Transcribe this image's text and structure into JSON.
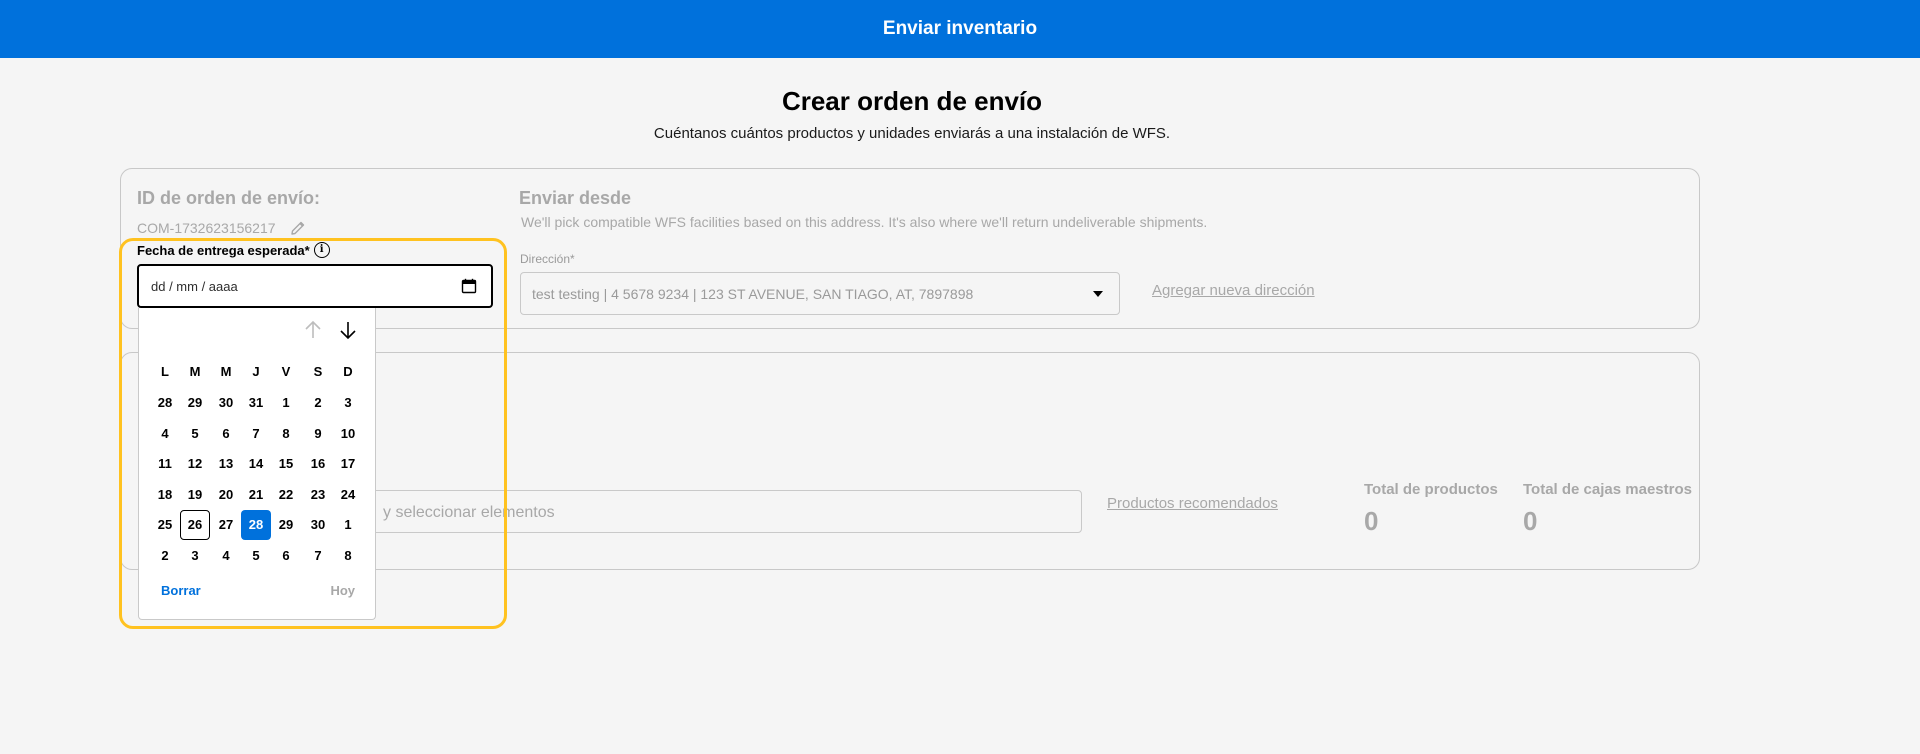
{
  "header": {
    "title": "Enviar inventario"
  },
  "page": {
    "title": "Crear orden de envío",
    "subtitle": "Cuéntanos cuántos productos y unidades enviarás a una instalación de WFS."
  },
  "shipment": {
    "id_label": "ID de orden de envío:",
    "id_value": "COM-1732623156217"
  },
  "ship_from": {
    "title": "Enviar desde",
    "description": "We'll pick compatible WFS facilities based on this address. It's also where we'll return undeliverable shipments.",
    "address_label": "Dirección*",
    "address_value": "test testing | 4 5678 9234 | 123 ST AVENUE, SAN TIAGO, AT, 7897898",
    "add_new_link": "Agregar nueva dirección"
  },
  "products": {
    "search_placeholder": "y seleccionar elementos",
    "recommended_link": "Productos recomendados",
    "total_products_label": "Total de productos",
    "total_products_value": "0",
    "total_boxes_label": "Total de cajas maestros",
    "total_boxes_value": "0"
  },
  "date_field": {
    "label": "Fecha de entrega esperada*",
    "info_icon": "i",
    "placeholder": "dd / mm / aaaa"
  },
  "calendar": {
    "weekdays": [
      "L",
      "M",
      "M",
      "J",
      "V",
      "S",
      "D"
    ],
    "weeks": [
      [
        "28",
        "29",
        "30",
        "31",
        "1",
        "2",
        "3"
      ],
      [
        "4",
        "5",
        "6",
        "7",
        "8",
        "9",
        "10"
      ],
      [
        "11",
        "12",
        "13",
        "14",
        "15",
        "16",
        "17"
      ],
      [
        "18",
        "19",
        "20",
        "21",
        "22",
        "23",
        "24"
      ],
      [
        "25",
        "26",
        "27",
        "28",
        "29",
        "30",
        "1"
      ],
      [
        "2",
        "3",
        "4",
        "5",
        "6",
        "7",
        "8"
      ]
    ],
    "today_day": "26",
    "selected_day": "28",
    "clear_label": "Borrar",
    "today_label": "Hoy"
  },
  "colors": {
    "primary": "#0071dc",
    "highlight": "#ffc220",
    "muted_text": "#a8a8a8"
  }
}
